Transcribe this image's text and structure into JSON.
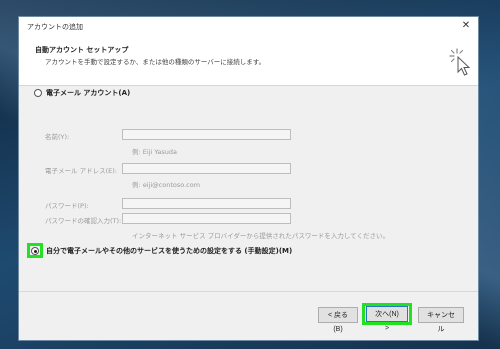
{
  "window": {
    "title": "アカウントの追加"
  },
  "header": {
    "title": "自動アカウント セットアップ",
    "subtitle": "アカウントを手動で設定するか、または他の種類のサーバーに接続します。",
    "icon": "wizard-sparkle-icon"
  },
  "options": {
    "email_account": {
      "label": "電子メール アカウント(A)",
      "selected": false
    },
    "manual_setup": {
      "label": "自分で電子メールやその他のサービスを使うための設定をする (手動設定)(M)",
      "selected": true
    }
  },
  "form": {
    "name": {
      "label": "名前(Y):",
      "value": "",
      "hint": "例: Eiji Yasuda"
    },
    "email": {
      "label": "電子メール アドレス(E):",
      "value": "",
      "hint": "例: eiji@contoso.com"
    },
    "password": {
      "label": "パスワード(P):",
      "value": ""
    },
    "password_confirm": {
      "label": "パスワードの確認入力(T):",
      "value": "",
      "hint": "インターネット サービス プロバイダーから提供されたパスワードを入力してください。"
    }
  },
  "buttons": {
    "back": "< 戻る(B)",
    "next": "次へ(N) >",
    "cancel": "キャンセル"
  },
  "colors": {
    "highlight": "#22e022",
    "accent": "#2a74c8"
  }
}
